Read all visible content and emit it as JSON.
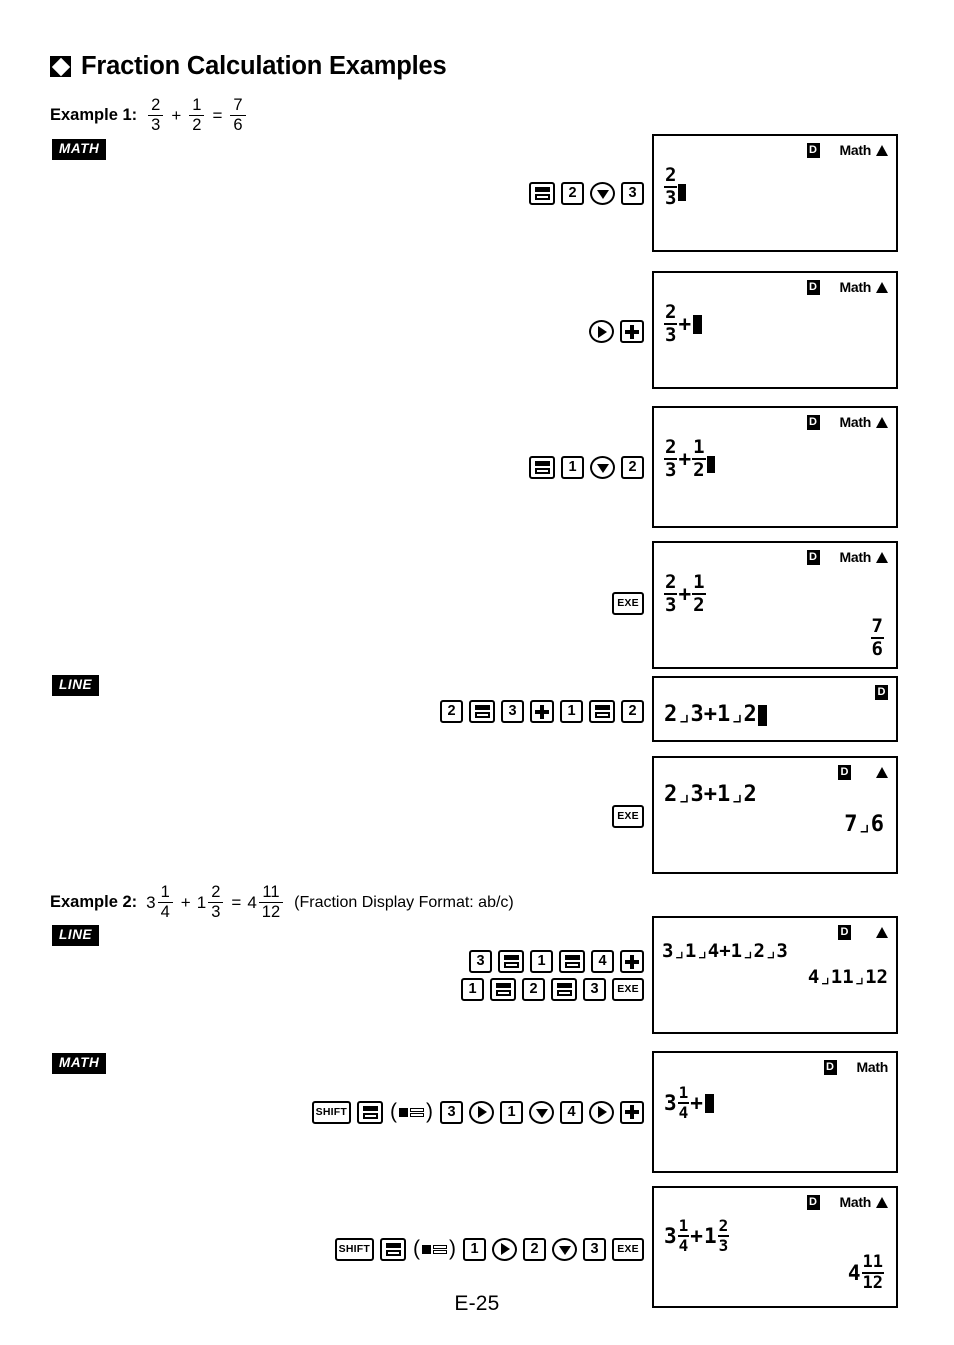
{
  "document": {
    "title": "Fraction Calculation Examples",
    "bullet_icon": "diamond-bullet-icon",
    "footer_page": "E-25"
  },
  "examples": [
    {
      "label": "Example 1:",
      "expression": {
        "term1": {
          "num": "2",
          "den": "3"
        },
        "op1": "+",
        "term2": {
          "num": "1",
          "den": "2"
        },
        "eq": "=",
        "result": {
          "num": "7",
          "den": "6"
        }
      },
      "note": "",
      "mode_tags": [
        "MATH",
        "LINE"
      ]
    },
    {
      "label": "Example 2:",
      "expression": {
        "term1": {
          "whole": "3",
          "num": "1",
          "den": "4"
        },
        "op1": "+",
        "term2": {
          "whole": "1",
          "num": "2",
          "den": "3"
        },
        "eq": "=",
        "result": {
          "whole": "4",
          "num": "11",
          "den": "12"
        }
      },
      "note": "(Fraction Display Format: ab/c)",
      "mode_tags": [
        "LINE",
        "MATH"
      ]
    }
  ],
  "mode_tags": {
    "math": "MATH",
    "line": "LINE"
  },
  "key_labels": {
    "shift": "SHIFT",
    "exe": "EXE",
    "plus": "plus-key-icon",
    "frac": "fraction-key-icon",
    "right": "right-arrow-key-icon",
    "down": "down-arrow-key-icon",
    "one": "1",
    "two": "2",
    "three": "3",
    "four": "4",
    "open_paren": "(",
    "close_paren": ")"
  },
  "key_sequences": [
    {
      "id": "seq-1",
      "keys": [
        "frac",
        "2",
        "down",
        "3"
      ]
    },
    {
      "id": "seq-2",
      "keys": [
        "right",
        "plus"
      ]
    },
    {
      "id": "seq-3",
      "keys": [
        "frac",
        "1",
        "down",
        "2"
      ]
    },
    {
      "id": "seq-4",
      "keys": [
        "EXE"
      ]
    },
    {
      "id": "seq-5",
      "keys": [
        "2",
        "frac",
        "3",
        "plus",
        "1",
        "frac",
        "2"
      ]
    },
    {
      "id": "seq-6",
      "keys": [
        "EXE"
      ]
    },
    {
      "id": "seq-7a",
      "keys": [
        "3",
        "frac",
        "1",
        "frac",
        "4",
        "plus"
      ]
    },
    {
      "id": "seq-7b",
      "keys": [
        "1",
        "frac",
        "2",
        "frac",
        "3",
        "EXE"
      ]
    },
    {
      "id": "seq-8",
      "keys": [
        "SHIFT",
        "frac",
        "(mixed)",
        "3",
        "right",
        "1",
        "down",
        "4",
        "right",
        "plus"
      ]
    },
    {
      "id": "seq-9",
      "keys": [
        "SHIFT",
        "frac",
        "(mixed)",
        "1",
        "right",
        "2",
        "down",
        "3",
        "EXE"
      ]
    }
  ],
  "screens": [
    {
      "id": "screen-1",
      "indicator_d": "D",
      "indicator_mode": "Math",
      "indicator_up_arrow": true,
      "entry": {
        "type": "fraction",
        "num": "2",
        "den": "3",
        "cursor_after_den": true
      },
      "answer": null
    },
    {
      "id": "screen-2",
      "indicator_d": "D",
      "indicator_mode": "Math",
      "indicator_up_arrow": true,
      "entry": {
        "type": "fraction-plus-cursor",
        "num": "2",
        "den": "3",
        "op": "+"
      },
      "answer": null
    },
    {
      "id": "screen-3",
      "indicator_d": "D",
      "indicator_mode": "Math",
      "indicator_up_arrow": true,
      "entry": {
        "type": "two-fractions",
        "f1_num": "2",
        "f1_den": "3",
        "op": "+",
        "f2_num": "1",
        "f2_den": "2",
        "cursor_after_f2_den": true
      },
      "answer": null
    },
    {
      "id": "screen-4",
      "indicator_d": "D",
      "indicator_mode": "Math",
      "indicator_up_arrow": true,
      "entry": {
        "type": "two-fractions",
        "f1_num": "2",
        "f1_den": "3",
        "op": "+",
        "f2_num": "1",
        "f2_den": "2",
        "cursor_after_f2_den": false
      },
      "answer": {
        "type": "fraction",
        "num": "7",
        "den": "6"
      }
    },
    {
      "id": "screen-5",
      "indicator_d": "D",
      "indicator_mode": "",
      "indicator_up_arrow": false,
      "entry": {
        "type": "line",
        "text": "2⌟3+1⌟2",
        "cursor": true
      },
      "answer": null
    },
    {
      "id": "screen-6",
      "indicator_d": "D",
      "indicator_mode": "",
      "indicator_up_arrow": true,
      "entry": {
        "type": "line",
        "text": "2⌟3+1⌟2",
        "cursor": false
      },
      "answer": {
        "type": "line",
        "text": "7⌟6"
      }
    },
    {
      "id": "screen-7",
      "indicator_d": "D",
      "indicator_mode": "",
      "indicator_up_arrow": true,
      "entry": {
        "type": "line",
        "text": "3⌟1⌟4+1⌟2⌟3",
        "cursor": false
      },
      "answer": {
        "type": "line",
        "text": "4⌟11⌟12"
      }
    },
    {
      "id": "screen-8",
      "indicator_d": "D",
      "indicator_mode": "Math",
      "indicator_up_arrow": false,
      "entry": {
        "type": "mixed-plus-cursor",
        "whole": "3",
        "num": "1",
        "den": "4",
        "op": "+"
      },
      "answer": null
    },
    {
      "id": "screen-9",
      "indicator_d": "D",
      "indicator_mode": "Math",
      "indicator_up_arrow": true,
      "entry": {
        "type": "two-mixed",
        "m1_whole": "3",
        "m1_num": "1",
        "m1_den": "4",
        "op": "+",
        "m2_whole": "1",
        "m2_num": "2",
        "m2_den": "3"
      },
      "answer": {
        "type": "mixed",
        "whole": "4",
        "num": "11",
        "den": "12"
      }
    }
  ]
}
